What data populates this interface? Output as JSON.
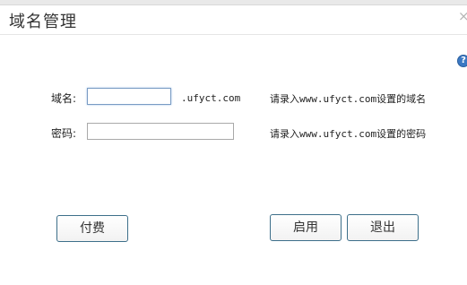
{
  "dialog": {
    "title": "域名管理",
    "close_glyph": "×",
    "help_glyph": "?"
  },
  "form": {
    "domain_label": "域名:",
    "domain_value": "",
    "domain_suffix": ".ufyct.com",
    "domain_hint": "请录入www.ufyct.com设置的域名",
    "password_label": "密码:",
    "password_value": "",
    "password_hint": "请录入www.ufyct.com设置的密码"
  },
  "buttons": {
    "pay": "付费",
    "enable": "启用",
    "exit": "退出"
  },
  "icons": {
    "close": "close-icon",
    "help": "help-icon"
  },
  "colors": {
    "help_blue": "#3b78c3",
    "button_border": "#3d6f8a"
  }
}
